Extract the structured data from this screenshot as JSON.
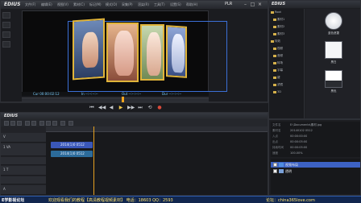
{
  "player": {
    "app_name": "EDIUS",
    "menu": [
      "文件(F)",
      "编辑(E)",
      "视图(V)",
      "素材(C)",
      "标记(M)",
      "模式(O)",
      "采集(P)",
      "渲染(R)",
      "工具(T)",
      "设置(S)",
      "帮助(H)"
    ],
    "mode_label": "PLR",
    "timecodes": {
      "cur": "Cur 00:00:02:12",
      "in": "In --:--:--:--",
      "out": "Out --:--:--:--",
      "dur": "Dur --:--:--:--"
    }
  },
  "transport": {
    "buttons": [
      "⏮",
      "◀◀",
      "◀",
      "▶",
      "▶▶",
      "⏭",
      "⟲",
      "●"
    ]
  },
  "timeline": {
    "app_name": "EDIUS",
    "tracks": [
      "V",
      "1 VA",
      "",
      "1 T",
      "",
      "A"
    ],
    "clips": [
      {
        "label": "2014(1)0 0512",
        "color": "#3a57b8"
      },
      {
        "label": "2014(1)0 0512",
        "color": "#2c6b9a"
      }
    ]
  },
  "bin": {
    "app_name": "EDIUS",
    "tree": [
      "Root",
      "素材1",
      "素材2",
      "素材3",
      "特效",
      "视频",
      "音频",
      "转场",
      "字幕",
      "键",
      "滤镜",
      "3D"
    ],
    "thumb_labels": [
      "蓝色遮罩",
      "黑白",
      "黑色"
    ]
  },
  "info": {
    "rows": [
      {
        "k": "文件名",
        "v": "E:\\Documents\\素材.jpg"
      },
      {
        "k": "素材名",
        "v": "20140102 0512"
      },
      {
        "k": "入点",
        "v": "00:00:00:00"
      },
      {
        "k": "出点",
        "v": "00:00:05:00"
      },
      {
        "k": "持续时间",
        "v": "00:00:05:00"
      },
      {
        "k": "速度",
        "v": "100.00%"
      }
    ],
    "layers": [
      {
        "label": "视频布局",
        "active": true
      },
      {
        "label": "透明",
        "active": false
      }
    ]
  },
  "banner": {
    "site": "E学影视论坛",
    "main": "欢迎观看我们的教程【高清教程视频素材】  电话：18603  QQ：2593",
    "right": "论坛：china365love.com"
  }
}
